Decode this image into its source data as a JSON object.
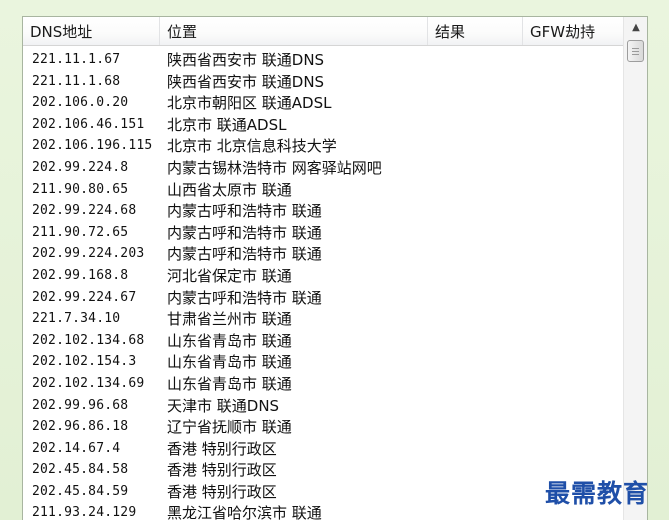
{
  "list": {
    "columns": [
      "DNS地址",
      "位置",
      "结果",
      "GFW劫持"
    ],
    "rows": [
      {
        "ip": "221.11.1.67",
        "location": "陕西省西安市 联通DNS"
      },
      {
        "ip": "221.11.1.68",
        "location": "陕西省西安市 联通DNS"
      },
      {
        "ip": "202.106.0.20",
        "location": "北京市朝阳区 联通ADSL"
      },
      {
        "ip": "202.106.46.151",
        "location": "北京市 联通ADSL"
      },
      {
        "ip": "202.106.196.115",
        "location": "北京市 北京信息科技大学"
      },
      {
        "ip": "202.99.224.8",
        "location": "内蒙古锡林浩特市 网客驿站网吧"
      },
      {
        "ip": "211.90.80.65",
        "location": "山西省太原市 联通"
      },
      {
        "ip": "202.99.224.68",
        "location": "内蒙古呼和浩特市 联通"
      },
      {
        "ip": "211.90.72.65",
        "location": "内蒙古呼和浩特市 联通"
      },
      {
        "ip": "202.99.224.203",
        "location": "内蒙古呼和浩特市 联通"
      },
      {
        "ip": "202.99.168.8",
        "location": "河北省保定市 联通"
      },
      {
        "ip": "202.99.224.67",
        "location": "内蒙古呼和浩特市 联通"
      },
      {
        "ip": "221.7.34.10",
        "location": "甘肃省兰州市 联通"
      },
      {
        "ip": "202.102.134.68",
        "location": "山东省青岛市 联通"
      },
      {
        "ip": "202.102.154.3",
        "location": "山东省青岛市 联通"
      },
      {
        "ip": "202.102.134.69",
        "location": "山东省青岛市 联通"
      },
      {
        "ip": "202.99.96.68",
        "location": "天津市 联通DNS"
      },
      {
        "ip": "202.96.86.18",
        "location": "辽宁省抚顺市 联通"
      },
      {
        "ip": "202.14.67.4",
        "location": "香港 特别行政区"
      },
      {
        "ip": "202.45.84.58",
        "location": "香港 特别行政区"
      },
      {
        "ip": "202.45.84.59",
        "location": "香港 特别行政区"
      },
      {
        "ip": "211.93.24.129",
        "location": "黑龙江省哈尔滨市 联通"
      }
    ]
  },
  "scrollbar": {
    "up_arrow_icon": "triangle-up"
  },
  "watermark": {
    "text": "最需教育"
  },
  "colors": {
    "background": "#e7f3dc",
    "watermark": "#1f4fa8"
  }
}
